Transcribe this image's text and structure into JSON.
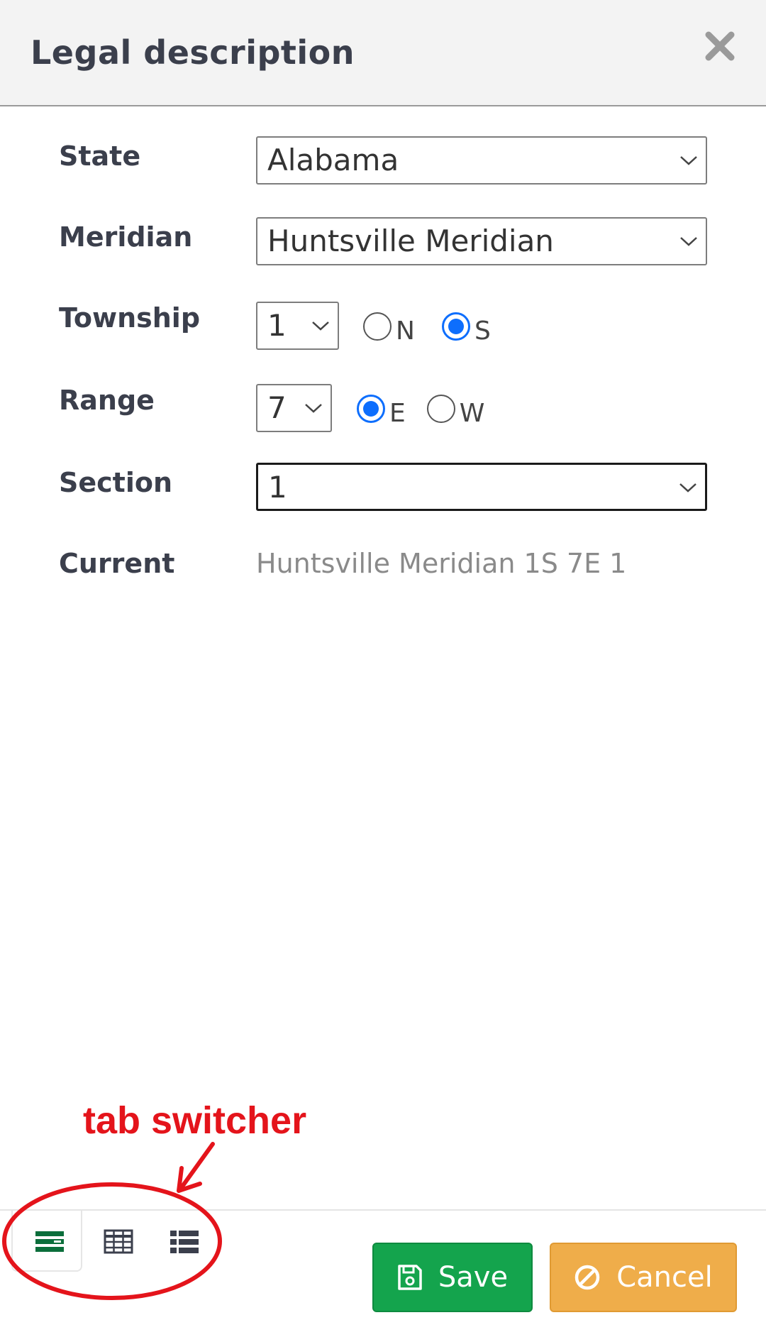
{
  "dialog": {
    "title": "Legal description"
  },
  "form": {
    "state": {
      "label": "State",
      "value": "Alabama"
    },
    "meridian": {
      "label": "Meridian",
      "value": "Huntsville Meridian"
    },
    "township": {
      "label": "Township",
      "value": "1",
      "options": [
        {
          "label": "N",
          "checked": false
        },
        {
          "label": "S",
          "checked": true
        }
      ]
    },
    "range": {
      "label": "Range",
      "value": "7",
      "options": [
        {
          "label": "E",
          "checked": true
        },
        {
          "label": "W",
          "checked": false
        }
      ]
    },
    "section": {
      "label": "Section",
      "value": "1"
    },
    "current": {
      "label": "Current",
      "value": "Huntsville Meridian 1S 7E 1"
    }
  },
  "footer": {
    "tabs": [
      {
        "icon": "form-icon",
        "active": true
      },
      {
        "icon": "table-icon",
        "active": false
      },
      {
        "icon": "list-icon",
        "active": false
      }
    ],
    "save_label": "Save",
    "cancel_label": "Cancel"
  },
  "annotation": {
    "text": "tab switcher",
    "color": "#e4141b"
  },
  "colors": {
    "accent_radio": "#0d6efd",
    "save": "#14a44d",
    "cancel": "#efad4a",
    "active_tab_icon": "#0b6e3b"
  }
}
